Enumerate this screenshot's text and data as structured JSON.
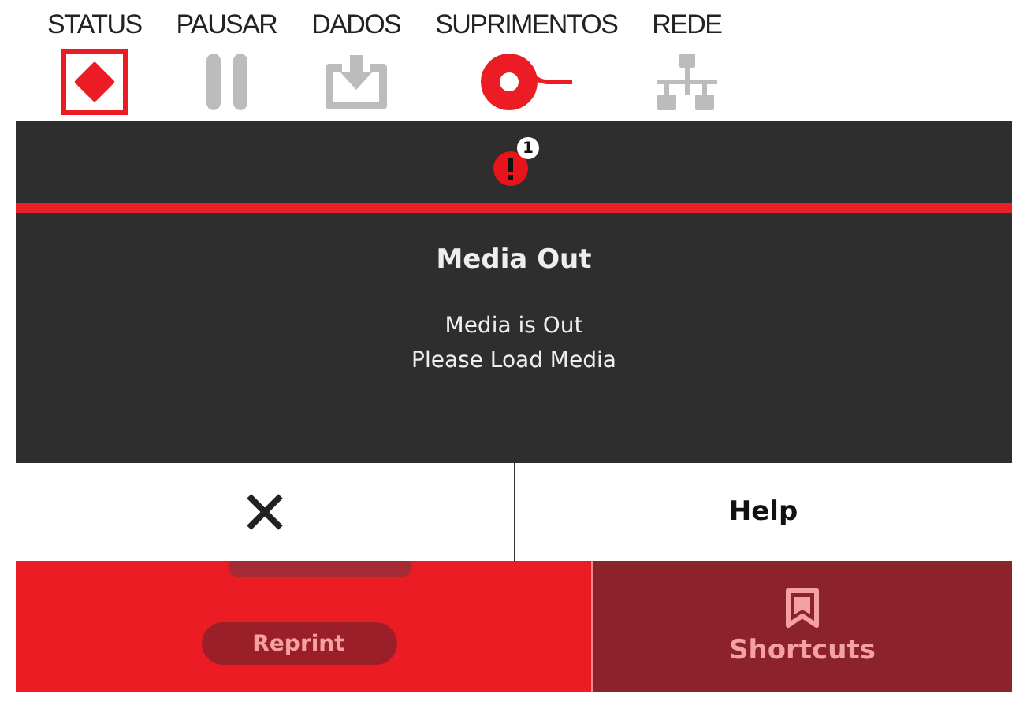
{
  "tabs": [
    {
      "label": "STATUS",
      "kind": "status",
      "alert": true,
      "selected": true
    },
    {
      "label": "PAUSAR",
      "kind": "pause",
      "alert": false,
      "selected": false
    },
    {
      "label": "DADOS",
      "kind": "data",
      "alert": false,
      "selected": false
    },
    {
      "label": "SUPRIMENTOS",
      "kind": "supplies",
      "alert": true,
      "selected": false
    },
    {
      "label": "REDE",
      "kind": "network",
      "alert": false,
      "selected": false
    }
  ],
  "alert_bar": {
    "count": "1"
  },
  "dialog": {
    "title": "Media Out",
    "lines": [
      "Media is Out",
      "Please Load Media"
    ],
    "help_button": "Help"
  },
  "bottom": {
    "reprint_button": "Reprint",
    "shortcuts_button": "Shortcuts"
  }
}
